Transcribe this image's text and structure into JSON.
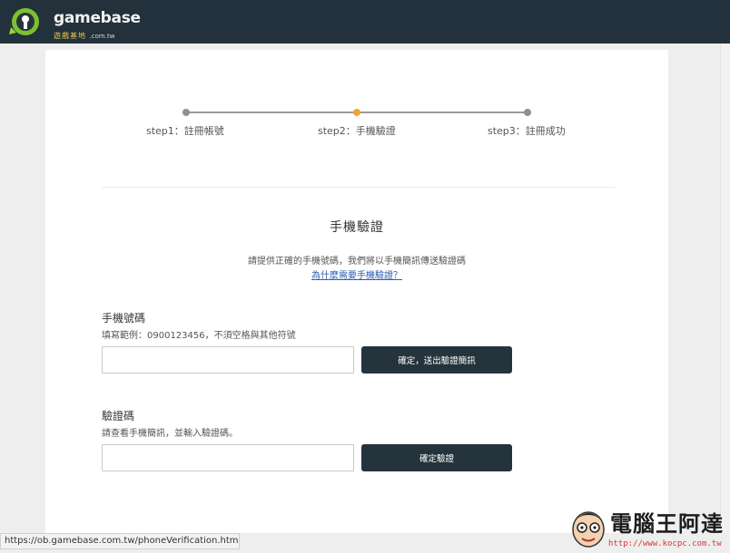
{
  "header": {
    "logo_text": "gamebase",
    "logo_subtitle": "遊戲基地",
    "logo_domain": ".com.tw"
  },
  "steps": [
    {
      "label": "step1：註冊帳號",
      "state": "done"
    },
    {
      "label": "step2：手機驗證",
      "state": "active"
    },
    {
      "label": "step3：註冊成功",
      "state": "pending"
    }
  ],
  "colors": {
    "header_bg": "#22313b",
    "active_step": "#f0a234",
    "button_bg": "#25333c",
    "link": "#2a5db0"
  },
  "main": {
    "title": "手機驗證",
    "description": "請提供正確的手機號碼，我們將以手機簡訊傳送驗證碼",
    "why_link": "為什麼需要手機驗證？"
  },
  "phone_section": {
    "label": "手機號碼",
    "hint": "填寫範例：0900123456，不須空格與其他符號",
    "input_value": "",
    "button_label": "確定，送出驗證簡訊"
  },
  "code_section": {
    "label": "驗證碼",
    "hint": "請查看手機簡訊，並輸入驗證碼。",
    "input_value": "",
    "button_label": "確定驗證"
  },
  "statusbar": {
    "url": "https://ob.gamebase.com.tw/phoneVerification.html#"
  },
  "watermark": {
    "title": "電腦王阿達",
    "url": "http://www.kocpc.com.tw"
  }
}
